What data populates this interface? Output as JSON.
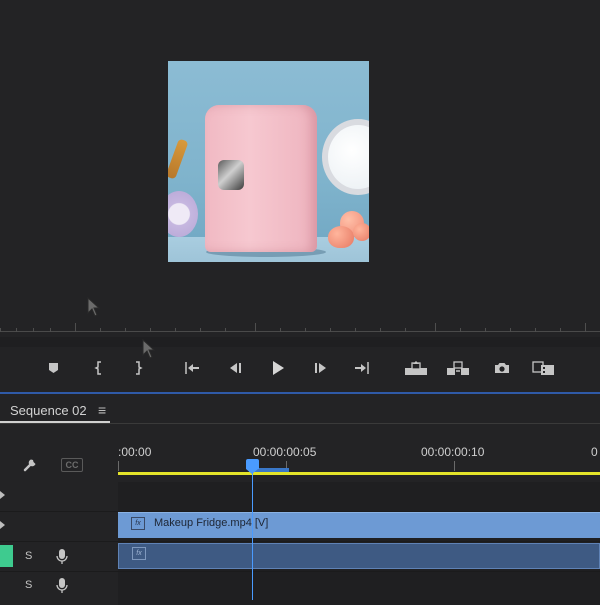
{
  "transport": {
    "buttons": [
      "add-marker",
      "mark-in",
      "mark-out",
      "go-to-in",
      "step-back",
      "play",
      "step-forward",
      "go-to-out",
      "lift",
      "extract",
      "export-frame",
      "comparison-view"
    ]
  },
  "preview": {
    "content": "pink mini fridge product photo"
  },
  "timeline": {
    "sequence_tab": "Sequence 02",
    "menu_glyph": "≡",
    "timecodes": [
      ":00:00",
      "00:00:00:05",
      "00:00:00:10",
      "0"
    ],
    "cc_label": "CC",
    "video_clip_label": "Makeup Fridge.mp4 [V]",
    "fx_label": "fx",
    "audio_tracks": [
      {
        "solo": "S"
      },
      {
        "solo": "S"
      }
    ]
  },
  "colors": {
    "work_area": "#e4e42a",
    "playhead": "#4a9bff",
    "video_clip": "#6d9ad4",
    "audio_clip": "#3e5a83",
    "audio_target": "#3ecb8f"
  }
}
